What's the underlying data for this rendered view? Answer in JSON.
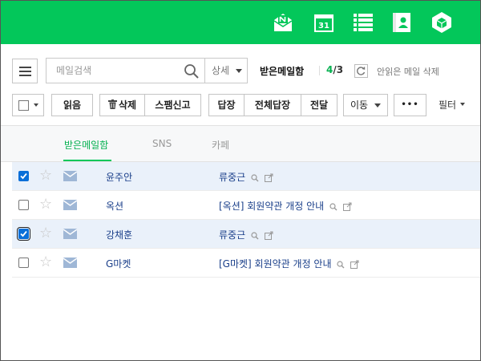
{
  "header": {
    "brand_color": "#03c75a",
    "icons": [
      "mail-n-icon",
      "calendar-icon",
      "list-icon",
      "contacts-icon",
      "cube-icon"
    ],
    "calendar_day": "31"
  },
  "search": {
    "placeholder": "메일검색",
    "detail_label": "상세"
  },
  "mailbox": {
    "title": "받은메일함",
    "unread": "4",
    "slash": "/",
    "total": "3",
    "delete_unread_label": "안읽은 메일 삭제"
  },
  "toolbar": {
    "read": "읽음",
    "delete": "삭제",
    "spam": "스팸신고",
    "reply": "답장",
    "reply_all": "전체답장",
    "forward": "전달",
    "move": "이동",
    "more": "•••",
    "filter": "필터"
  },
  "tabs": [
    {
      "label": "받은메일함",
      "active": true
    },
    {
      "label": "SNS",
      "active": false
    },
    {
      "label": "카페",
      "active": false
    }
  ],
  "rows": [
    {
      "checked": true,
      "sender": "윤주안",
      "subject": "류중근",
      "selected": true
    },
    {
      "checked": false,
      "sender": "옥션",
      "subject": "[옥션] 회원약관 개정 안내",
      "selected": false
    },
    {
      "checked": true,
      "sender": "강채훈",
      "subject": "류중근",
      "selected": true
    },
    {
      "checked": false,
      "sender": "G마켓",
      "subject": "[G마켓] 회원약관 개정 안내",
      "selected": false
    }
  ]
}
